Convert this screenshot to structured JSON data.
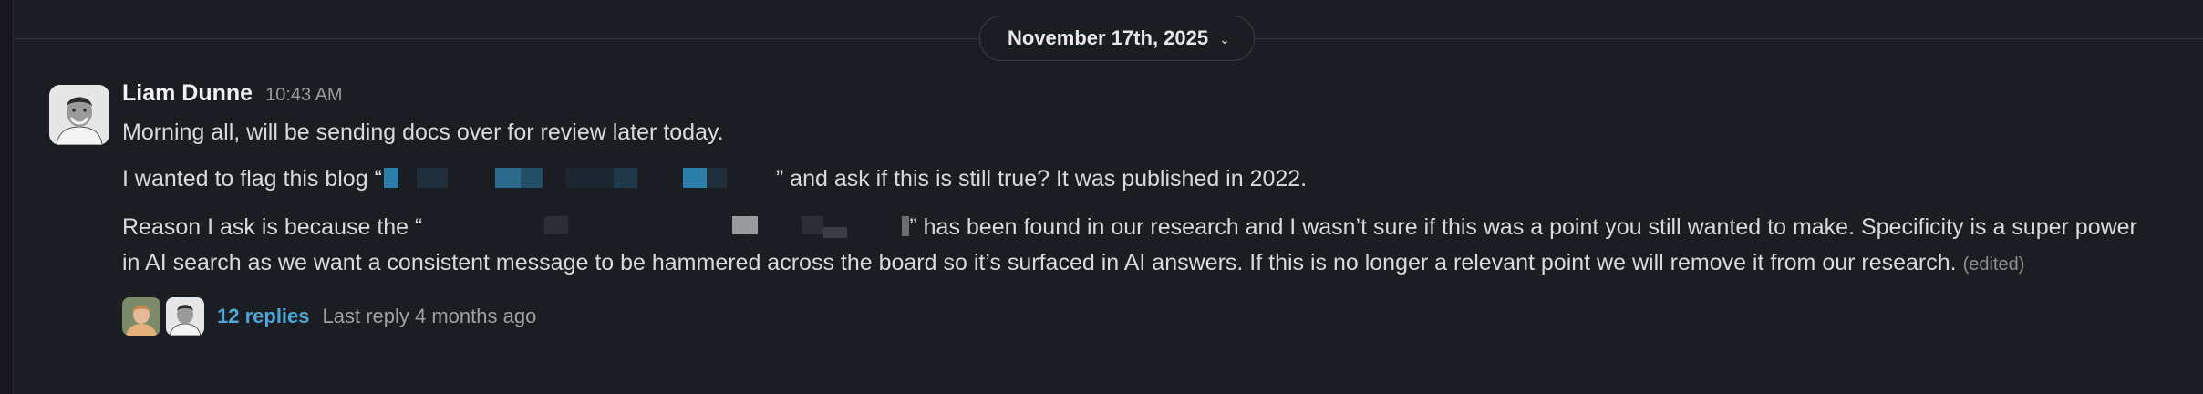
{
  "date_divider": {
    "label": "November 17th, 2025",
    "icon": "chevron-down-icon"
  },
  "message": {
    "sender": "Liam Dunne",
    "time": "10:43 AM",
    "paragraph1": "Morning all, will be sending docs over for review later today.",
    "paragraph2_before": "I wanted to flag this blog “",
    "paragraph2_after": "” and ask if this is still true? It was published in 2022.",
    "paragraph3_before": "Reason I ask is because the “",
    "paragraph3_after": "” has been found in our research and I wasn’t sure if this was a point you still wanted to make. Specificity is a super power in AI search as we want a consistent message to be hammered across the board so it’s surfaced in AI answers. If this is no longer a relevant point we will remove it from our research.",
    "edited_label": "(edited)"
  },
  "thread": {
    "replies_label": "12 replies",
    "last_reply_label": "Last reply 4 months ago"
  },
  "colors": {
    "background": "#1a1d21",
    "link": "#4da6d6",
    "redaction_blue": "#2b7ea7"
  }
}
